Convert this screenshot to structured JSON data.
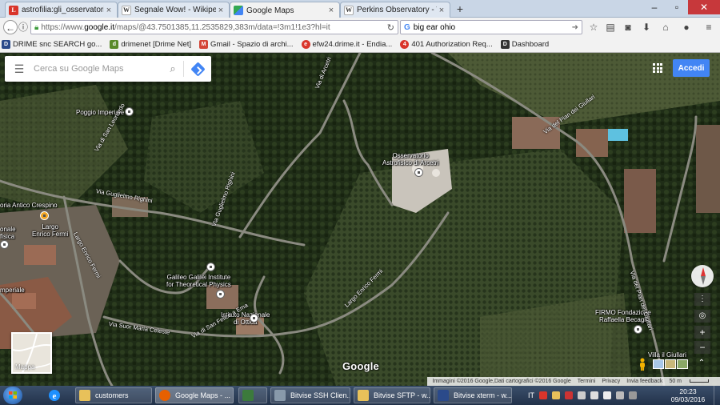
{
  "browser": {
    "tabs": [
      {
        "label": "astrofilia:gli_osservatori_ast...",
        "favicon": "L",
        "favicon_color": "#d9352b"
      },
      {
        "label": "Segnale Wow! - Wikipedia",
        "favicon": "W",
        "favicon_color": "#555555"
      },
      {
        "label": "Google Maps",
        "favicon": "",
        "favicon_color": "#34a853"
      },
      {
        "label": "Perkins Observatory - Wiki...",
        "favicon": "W",
        "favicon_color": "#555555"
      }
    ],
    "url_prefix": "https://www.",
    "url_domain": "google.it",
    "url_rest": "/maps/@43.7501385,11.2535829,383m/data=!3m1!1e3?hl=it",
    "search_value": "big ear ohio",
    "bookmarks": [
      {
        "label": "DRIME snc SEARCH go...",
        "color": "#2b4a8a",
        "glyph": "D"
      },
      {
        "label": "drimenet [Drime Net]",
        "color": "#5a8a2b",
        "glyph": "d"
      },
      {
        "label": "Gmail - Spazio di archi...",
        "color": "#d44638",
        "glyph": "M"
      },
      {
        "label": "efw24.drime.it - Endia...",
        "color": "#d9352b",
        "glyph": "e"
      },
      {
        "label": "401 Authorization Req...",
        "color": "#d9352b",
        "glyph": "4"
      },
      {
        "label": "Dashboard",
        "color": "#333333",
        "glyph": "D"
      }
    ]
  },
  "map": {
    "search_placeholder": "Cerca su Google Maps",
    "signin_label": "Accedi",
    "minimap_label": "Mappa",
    "logo": "Google",
    "places": {
      "poggio": "Poggio Imperiale",
      "osservatorio_1": "Osservatorio",
      "osservatorio_2": "Astrofisico di Arcetri",
      "crespino": "oria Antico Crespino",
      "fermi_1": "Largo",
      "fermi_2": "Enrico Fermi",
      "onale": "onale",
      "fisica": "fisica",
      "galileo_1": "Galileo Galilei Institute",
      "galileo_2": "for Theoretical Physics",
      "ottica_1": "Istituto Nazionale",
      "ottica_2": "di Ottica",
      "imperiale": "mperiale",
      "firmo_1": "FIRMO Fondazione",
      "firmo_2": "Raffaella Becagli",
      "giullari": "Villa il Giullari"
    },
    "roads": {
      "guglielmo": "Via Guglielmo Righini",
      "righini": "Via Guglielmo Righini",
      "arcetri": "Via di Arcetri",
      "fermi_road": "Largo Enrico Fermi",
      "fermi_left": "Largo Enrico Fermi",
      "celeste": "Via Suor Maria Celeste",
      "torre": "Via del Pian dei Giullari",
      "ercole": "Via di San Leonardo",
      "pian": "Via del Pian dei Giullari",
      "vianame": "Via di San Felice a Ema"
    },
    "footer": {
      "credits": "Immagini ©2016 Google,Dati cartografici ©2016 Google",
      "terms": "Termini",
      "privacy": "Privacy",
      "feedback": "Invia feedback",
      "scale": "50 m"
    }
  },
  "taskbar": {
    "tasks": [
      {
        "label": "customers",
        "color": "#e8c15a"
      },
      {
        "label": "Google Maps - ...",
        "color": "#e66000"
      },
      {
        "label": "",
        "color": "#3c7a3c"
      },
      {
        "label": "Bitvise SSH Clien...",
        "color": "#8899aa"
      },
      {
        "label": "Bitvise SFTP - w...",
        "color": "#e8c15a"
      },
      {
        "label": "Bitvise xterm - w...",
        "color": "#2b4a8a"
      }
    ],
    "lang": "IT",
    "time": "20:23",
    "date": "09/03/2016"
  }
}
